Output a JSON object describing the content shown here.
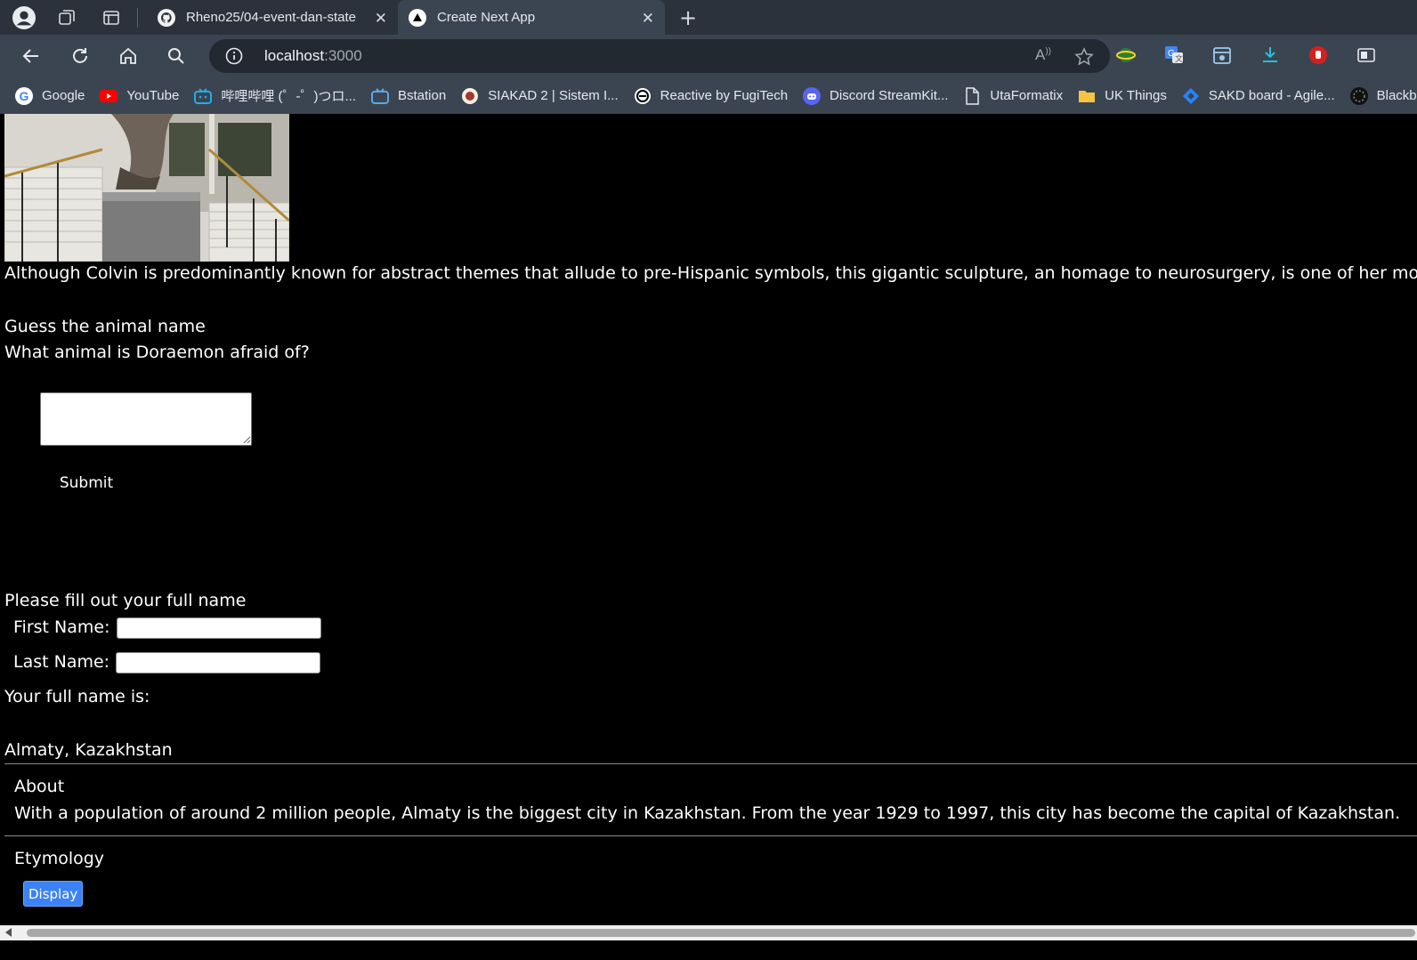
{
  "browser": {
    "tabs": [
      {
        "title": "Rheno25/04-event-dan-state",
        "active": false
      },
      {
        "title": "Create Next App",
        "active": true
      }
    ],
    "url_host": "localhost",
    "url_port": ":3000",
    "bookmarks": [
      {
        "label": "Google",
        "icon": "google-icon"
      },
      {
        "label": "YouTube",
        "icon": "youtube-icon"
      },
      {
        "label": "哔哩哔哩 (゜-゜)つロ...",
        "icon": "bilibili-icon"
      },
      {
        "label": "Bstation",
        "icon": "bstation-icon"
      },
      {
        "label": "SIAKAD 2 | Sistem I...",
        "icon": "siakad-icon"
      },
      {
        "label": "Reactive by FugiTech",
        "icon": "reactive-icon"
      },
      {
        "label": "Discord StreamKit...",
        "icon": "discord-icon"
      },
      {
        "label": "UtaFormatix",
        "icon": "document-icon"
      },
      {
        "label": "UK Things",
        "icon": "folder-icon"
      },
      {
        "label": "SAKD board - Agile...",
        "icon": "jira-icon"
      },
      {
        "label": "Blackbox",
        "icon": "blackbox-icon"
      }
    ]
  },
  "page": {
    "caption": "Although Colvin is predominantly known for abstract themes that allude to pre-Hispanic symbols, this gigantic sculpture, an homage to neurosurgery, is one of her most",
    "quiz": {
      "title": "Guess the animal name",
      "question": "What animal is Doraemon afraid of?",
      "answer_value": "",
      "submit_label": "Submit"
    },
    "name_form": {
      "title": "Please fill out your full name",
      "first_label": "First Name:",
      "first_value": "",
      "last_label": "Last Name:",
      "last_value": "",
      "result_label": "Your full name is:"
    },
    "city": {
      "name": "Almaty, Kazakhstan",
      "about_title": "About",
      "about_text": "With a population of around 2 million people, Almaty is the biggest city in Kazakhstan. From the year 1929 to 1997, this city has become the capital of Kazakhstan.",
      "etymology_title": "Etymology",
      "display_label": "Display"
    }
  },
  "colors": {
    "tabbar": "#2b323b",
    "toolbar": "#3b4552",
    "page_bg": "#000000",
    "display_button": "#3b82f6"
  }
}
